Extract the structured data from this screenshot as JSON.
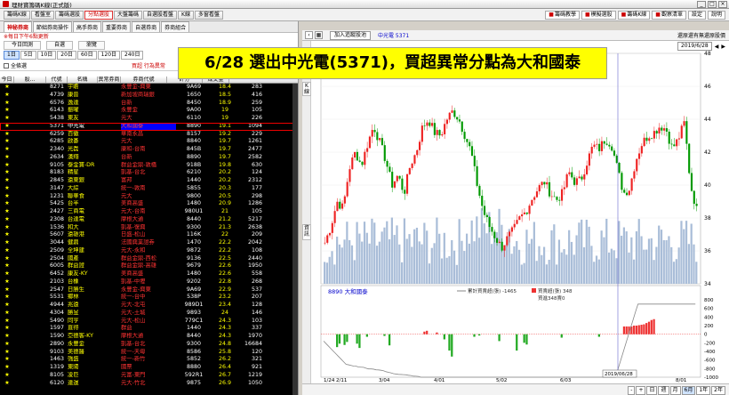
{
  "title": "理財寶籌碼K線(正式版)",
  "menu": [
    "籌碼K線",
    "看盤室",
    "籌碼選股",
    "分點選股",
    "大盤籌碼",
    "自選股看盤",
    "K線",
    "多窗看盤"
  ],
  "menu_active": 3,
  "toolbar_right": [
    "籌碼教學",
    "模擬選股",
    "籌碼K線",
    "觀察清單",
    "設定",
    "說明"
  ],
  "subtabs": [
    "神秘券商",
    "節絀券商操作",
    "高手券商",
    "重要券商",
    "自選券商",
    "券商組合"
  ],
  "warning": "※每日下午6點更新",
  "btns": [
    "今日回測",
    "自選",
    "瀏覽"
  ],
  "periods": [
    "1日",
    "5日",
    "10日",
    "20日",
    "60日",
    "120日",
    "240日"
  ],
  "period_active": 0,
  "check_label": "全條選",
  "mid_label": "買超 行為異常",
  "headers": [
    "今日",
    "股...",
    "代號",
    "名稱",
    "異常券商",
    "券商代號",
    "評分",
    "成交量"
  ],
  "rows": [
    [
      "8271",
      "宇瞻",
      "永豐金-興東",
      "9A69",
      "18.4",
      "283"
    ],
    [
      "4739",
      "康普",
      "新加坡商瑞銀",
      "1650",
      "18.5",
      "416"
    ],
    [
      "6576",
      "逸達",
      "台新",
      "8450",
      "18.9",
      "259"
    ],
    [
      "6143",
      "振曜",
      "永豐金",
      "9A00",
      "19",
      "105"
    ],
    [
      "5438",
      "東友",
      "元大",
      "6110",
      "19",
      "226"
    ],
    [
      "5371",
      "中光電",
      "大和國泰",
      "8890",
      "19.1",
      "1094"
    ],
    [
      "6259",
      "百徽",
      "華南永昌",
      "8157",
      "19.2",
      "229"
    ],
    [
      "6285",
      "啟碁",
      "元大",
      "8840",
      "19.7",
      "1261"
    ],
    [
      "2340",
      "光磊",
      "康和-台南",
      "845B",
      "19.7",
      "2477"
    ],
    [
      "2634",
      "漢翔",
      "台新",
      "8890",
      "19.7",
      "2582"
    ],
    [
      "9105",
      "泰金寶-DR",
      "群益金鼎-敦橋",
      "918B",
      "19.8",
      "630"
    ],
    [
      "8183",
      "精星",
      "凱基-台北",
      "6210",
      "20.2",
      "124"
    ],
    [
      "2845",
      "遠東銀",
      "富邦",
      "1440",
      "20.2",
      "2312"
    ],
    [
      "3147",
      "大綜",
      "統一-敦南",
      "5855",
      "20.3",
      "177"
    ],
    [
      "1231",
      "聯華食",
      "元大",
      "9800",
      "20.5",
      "298"
    ],
    [
      "5425",
      "台半",
      "美商高盛",
      "1480",
      "20.9",
      "1286"
    ],
    [
      "2427",
      "三商電",
      "元大-台南",
      "980U1",
      "21",
      "105"
    ],
    [
      "2308",
      "台達電",
      "摩根大通",
      "8440",
      "21.2",
      "5217"
    ],
    [
      "1536",
      "和大",
      "凱基-復興",
      "9300",
      "21.3",
      "2638"
    ],
    [
      "5607",
      "遠雄港",
      "日盛-松山",
      "116K",
      "22",
      "209"
    ],
    [
      "3044",
      "健鼎",
      "法國興業證券",
      "1470",
      "22.2",
      "2042"
    ],
    [
      "2509",
      "全坤建",
      "元大-永和",
      "9872",
      "22.2",
      "108"
    ],
    [
      "2504",
      "國產",
      "群益金鼎-西松",
      "9136",
      "22.5",
      "2440"
    ],
    [
      "6005",
      "群益證",
      "群益金鼎-高雄",
      "9679",
      "22.6",
      "1950"
    ],
    [
      "6452",
      "康友-KY",
      "美商高盛",
      "1480",
      "22.6",
      "558"
    ],
    [
      "2103",
      "台橡",
      "凱基-中壢",
      "9202",
      "22.8",
      "268"
    ],
    [
      "2547",
      "日勝生",
      "永豐金-興東",
      "9A69",
      "22.9",
      "537"
    ],
    [
      "5531",
      "鄉林",
      "統一-台中",
      "538P",
      "23.2",
      "207"
    ],
    [
      "4944",
      "兆遠",
      "元大-北屯",
      "989D1",
      "23.4",
      "128"
    ],
    [
      "4304",
      "勝昱",
      "元大-土城",
      "9893",
      "24",
      "146"
    ],
    [
      "5490",
      "同亨",
      "元大-松山",
      "779C1",
      "24.3",
      "103"
    ],
    [
      "1597",
      "直得",
      "群益",
      "1440",
      "24.3",
      "337"
    ],
    [
      "1590",
      "亞德客-KY",
      "摩根大通",
      "8440",
      "24.3",
      "1970"
    ],
    [
      "2890",
      "永豐金",
      "凱基-台北",
      "9300",
      "24.8",
      "16684"
    ],
    [
      "9103",
      "美德醫",
      "統一-天母",
      "8586",
      "25.8",
      "120"
    ],
    [
      "1463",
      "強盛",
      "統一-新竹",
      "5852",
      "26.2",
      "321"
    ],
    [
      "1319",
      "東陽",
      "國票",
      "8880",
      "26.4",
      "921"
    ],
    [
      "8105",
      "凌巨",
      "元富-東門",
      "592R1",
      "26.7",
      "1219"
    ],
    [
      "6120",
      "達運",
      "元大-竹北",
      "9875",
      "26.9",
      "1050"
    ]
  ],
  "selected_row": 5,
  "annotation": "6/28 選出中光電(5371)，買超異常分點為大和國泰",
  "chart_header": {
    "btn": "加入追蹤股池",
    "stock": "中光電 5371",
    "right": "還原還有無還原股價",
    "date": "2019/6/28"
  },
  "side_tabs": [
    "K線",
    "資訊"
  ],
  "bottom_ctrl": [
    "-",
    "+",
    "日",
    "週",
    "月",
    "6月",
    "1年",
    "2年"
  ],
  "bottom_active": 5,
  "chart_data": [
    {
      "type": "candlestick",
      "ylim": [
        34,
        48
      ],
      "yticks": [
        34,
        36,
        38,
        40,
        42,
        44,
        46,
        48
      ],
      "x_labels": [
        "1/24\n2019",
        "2/11",
        "3/04",
        "4/01",
        "5/02",
        "6/03",
        "8/01"
      ],
      "close_path": [
        36.5,
        37.5,
        39,
        38.6,
        41,
        42,
        41.2,
        42.5,
        43.6,
        42.6,
        41.5,
        40,
        40.6,
        39.5,
        41.2,
        42,
        43.5,
        44,
        43.2,
        43,
        44,
        44.5,
        44,
        43,
        42,
        40,
        38.4,
        37.5,
        36.8,
        36.2,
        36.8,
        37.3,
        38,
        38.4,
        39.2,
        39.8,
        40.2,
        39.5,
        39.1,
        39.5,
        40.8,
        40.2,
        40.3,
        41.4,
        42.4,
        42.2,
        42.8,
        42.5,
        41,
        39.5,
        39.8,
        41.5,
        42.5,
        43,
        43.2,
        43.6,
        43.4,
        42.2,
        42.8,
        43.8,
        40,
        38.5
      ]
    },
    {
      "type": "bar",
      "title": "8890 大和國泰",
      "legend": [
        "累計買賣超(張) -1465",
        "買賣超(張) 348",
        "買進348賣0"
      ],
      "ylim": [
        -1000,
        800
      ],
      "yticks": [
        800,
        600,
        400,
        200,
        0,
        -200,
        -400,
        -600,
        -800,
        -1000
      ],
      "date_tag": "2019/06/28"
    }
  ]
}
